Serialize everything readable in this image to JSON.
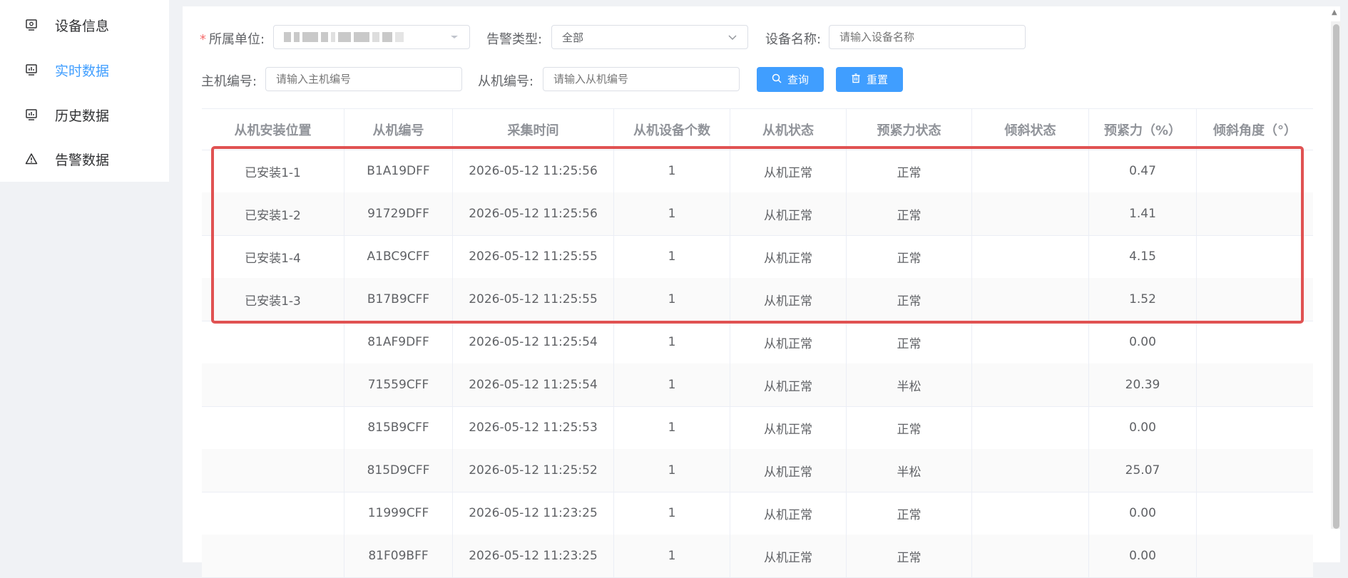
{
  "sidebar": {
    "items": [
      {
        "label": "设备信息",
        "icon": "monitor-icon",
        "active": false
      },
      {
        "label": "实时数据",
        "icon": "monitor-chart-icon",
        "active": true
      },
      {
        "label": "历史数据",
        "icon": "monitor-chart-icon",
        "active": false
      },
      {
        "label": "告警数据",
        "icon": "warning-icon",
        "active": false
      }
    ]
  },
  "filters": {
    "unit_label": "所属单位:",
    "alarm_type_label": "告警类型:",
    "alarm_type_value": "全部",
    "device_name_label": "设备名称:",
    "device_name_placeholder": "请输入设备名称",
    "host_no_label": "主机编号:",
    "host_no_placeholder": "请输入主机编号",
    "slave_no_label": "从机编号:",
    "slave_no_placeholder": "请输入从机编号",
    "query_label": "查询",
    "reset_label": "重置"
  },
  "table": {
    "columns": [
      "从机安装位置",
      "从机编号",
      "采集时间",
      "从机设备个数",
      "从机状态",
      "预紧力状态",
      "倾斜状态",
      "预紧力（%）",
      "倾斜角度（°）"
    ],
    "rows": [
      [
        "已安装1-1",
        "B1A19DFF",
        "2026-05-12 11:25:56",
        "1",
        "从机正常",
        "正常",
        "",
        "0.47",
        ""
      ],
      [
        "已安装1-2",
        "91729DFF",
        "2026-05-12 11:25:56",
        "1",
        "从机正常",
        "正常",
        "",
        "1.41",
        ""
      ],
      [
        "已安装1-4",
        "A1BC9CFF",
        "2026-05-12 11:25:55",
        "1",
        "从机正常",
        "正常",
        "",
        "4.15",
        ""
      ],
      [
        "已安装1-3",
        "B17B9CFF",
        "2026-05-12 11:25:55",
        "1",
        "从机正常",
        "正常",
        "",
        "1.52",
        ""
      ],
      [
        "",
        "81AF9DFF",
        "2026-05-12 11:25:54",
        "1",
        "从机正常",
        "正常",
        "",
        "0.00",
        ""
      ],
      [
        "",
        "71559CFF",
        "2026-05-12 11:25:54",
        "1",
        "从机正常",
        "半松",
        "",
        "20.39",
        ""
      ],
      [
        "",
        "815B9CFF",
        "2026-05-12 11:25:53",
        "1",
        "从机正常",
        "正常",
        "",
        "0.00",
        ""
      ],
      [
        "",
        "815D9CFF",
        "2026-05-12 11:25:52",
        "1",
        "从机正常",
        "半松",
        "",
        "25.07",
        ""
      ],
      [
        "",
        "11999CFF",
        "2026-05-12 11:23:25",
        "1",
        "从机正常",
        "正常",
        "",
        "0.00",
        ""
      ],
      [
        "",
        "81F09BFF",
        "2026-05-12 11:23:25",
        "1",
        "从机正常",
        "正常",
        "",
        "0.00",
        ""
      ]
    ]
  },
  "colors": {
    "accent": "#409eff",
    "highlight": "#e05252"
  }
}
